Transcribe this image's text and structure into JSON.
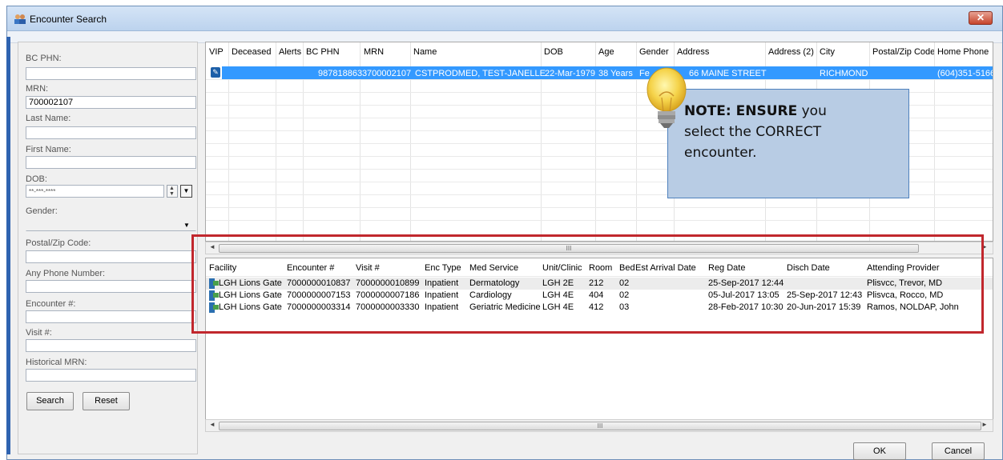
{
  "window": {
    "title": "Encounter Search"
  },
  "search": {
    "bc_phn_label": "BC PHN:",
    "bc_phn_value": "",
    "mrn_label": "MRN:",
    "mrn_value": "700002107",
    "last_name_label": "Last Name:",
    "first_name_label": "First Name:",
    "dob_label": "DOB:",
    "dob_value": "**-***-****",
    "gender_label": "Gender:",
    "postal_label": "Postal/Zip Code:",
    "phone_label": "Any Phone Number:",
    "encounter_label": "Encounter #:",
    "visit_label": "Visit #:",
    "historical_mrn_label": "Historical MRN:",
    "search_button": "Search",
    "reset_button": "Reset"
  },
  "patient_grid": {
    "columns": [
      "VIP",
      "Deceased",
      "Alerts",
      "BC PHN",
      "MRN",
      "Name",
      "DOB",
      "Age",
      "Gender",
      "Address",
      "Address (2)",
      "City",
      "Postal/Zip Code",
      "Home Phone"
    ],
    "selected_row": {
      "bc_phn": "9878188633",
      "mrn": "700002107",
      "name": "CSTPRODMED, TEST-JANELLE",
      "dob": "22-Mar-1979",
      "age": "38 Years",
      "gender": "Fe",
      "address": "66 MAINE STREET",
      "city": "RICHMOND",
      "home_phone": "(604)351-5166"
    }
  },
  "encounter_grid": {
    "columns": [
      "Facility",
      "Encounter #",
      "Visit #",
      "Enc Type",
      "Med Service",
      "Unit/Clinic",
      "Room",
      "Bed",
      "Est Arrival Date",
      "Reg Date",
      "Disch Date",
      "Attending Provider"
    ],
    "rows": [
      [
        "LGH Lions Gate",
        "7000000010837",
        "7000000010899",
        "Inpatient",
        "Dermatology",
        "LGH 2E",
        "212",
        "02",
        "",
        "25-Sep-2017 12:44",
        "",
        "Plisvcc, Trevor, MD"
      ],
      [
        "LGH Lions Gate",
        "7000000007153",
        "7000000007186",
        "Inpatient",
        "Cardiology",
        "LGH 4E",
        "404",
        "02",
        "",
        "05-Jul-2017 13:05",
        "25-Sep-2017 12:43",
        "Plisvca, Rocco, MD"
      ],
      [
        "LGH Lions Gate",
        "7000000003314",
        "7000000003330",
        "Inpatient",
        "Geriatric Medicine",
        "LGH 4E",
        "412",
        "03",
        "",
        "28-Feb-2017 10:30",
        "20-Jun-2017 15:39",
        "Ramos, NOLDAP, John"
      ]
    ]
  },
  "note": {
    "bold": "NOTE: ENSURE",
    "line1_rest": " you",
    "line2": "select the CORRECT",
    "line3": "encounter."
  },
  "scroll_text": "III",
  "footer": {
    "ok": "OK",
    "cancel": "Cancel"
  },
  "colors": {
    "selection": "#3399ff",
    "highlight_box": "#c1272d",
    "note_bg": "#b8cce4"
  }
}
